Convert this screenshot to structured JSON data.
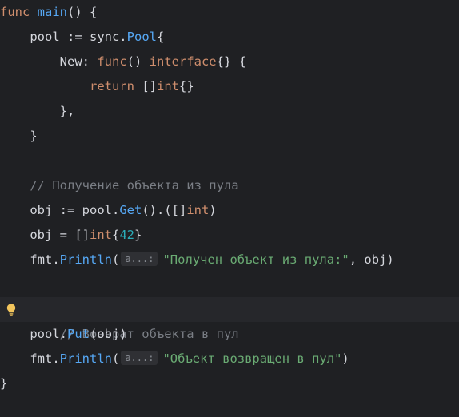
{
  "colors": {
    "background": "#1f2023",
    "keyword": "#cf8e6d",
    "function": "#56a8f5",
    "number": "#2aacb8",
    "string": "#6aab73",
    "comment": "#7a7e85",
    "text": "#d4d6dc"
  },
  "code": {
    "l1": {
      "a": "func",
      "b": " ",
      "c": "main",
      "d": "() {"
    },
    "l2": {
      "a": "pool := sync.",
      "b": "Pool",
      "c": "{"
    },
    "l3": {
      "a": "New: ",
      "b": "func",
      "c": "() ",
      "d": "interface",
      "e": "{} {"
    },
    "l4": {
      "a": "return",
      "b": " []",
      "c": "int",
      "d": "{}"
    },
    "l5": {
      "a": "},"
    },
    "l6": {
      "a": "}"
    },
    "l7": {
      "a": "// Получение объекта из пула"
    },
    "l8": {
      "a": "obj := pool.",
      "b": "Get",
      "c": "().([]",
      "d": "int",
      "e": ")"
    },
    "l9": {
      "a": "obj = []",
      "b": "int",
      "c": "{",
      "d": "42",
      "e": "}"
    },
    "l10": {
      "a": "fmt.",
      "b": "Println",
      "c": "(",
      "hint": "a...:",
      "d": "\"Получен объект из пула:\"",
      "e": ", obj)"
    },
    "l11": {
      "a": "// Возврат объекта в пул"
    },
    "l12": {
      "a": "pool.",
      "b": "Put",
      "c": "(obj)"
    },
    "l13": {
      "a": "fmt.",
      "b": "Println",
      "c": "(",
      "hint": "a...:",
      "d": "\"Объект возвращен в пул\"",
      "e": ")"
    },
    "l14": {
      "a": "}"
    }
  },
  "icons": {
    "intention": "lightbulb-icon"
  }
}
